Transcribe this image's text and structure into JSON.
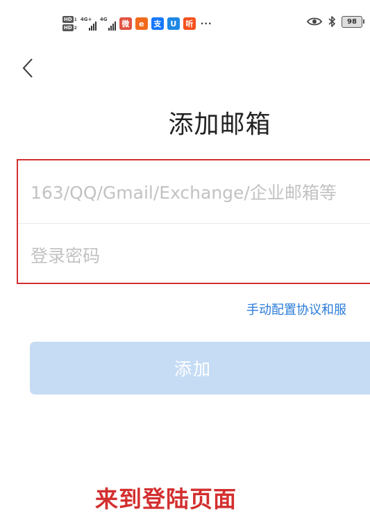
{
  "status_bar": {
    "hd1": "HD",
    "hd1_num": "1",
    "hd2": "HD",
    "hd2_num": "2",
    "net1": "4G+",
    "net2": "4G",
    "more": "···",
    "battery": "98",
    "apps": [
      {
        "icon": "weibo-app-icon",
        "glyph": "微",
        "color": "#e0523f"
      },
      {
        "icon": "aliexpress-app-icon",
        "glyph": "e",
        "color": "#f26b1d"
      },
      {
        "icon": "alipay-app-icon",
        "glyph": "支",
        "color": "#1677ff"
      },
      {
        "icon": "app-icon",
        "glyph": "U",
        "color": "#1e88e5"
      },
      {
        "icon": "listen-app-icon",
        "glyph": "听",
        "color": "#f4511e"
      }
    ]
  },
  "header": {
    "back_icon": "chevron-left-icon",
    "title": "添加邮箱"
  },
  "form": {
    "account_placeholder": "163/QQ/Gmail/Exchange/企业邮箱等",
    "password_placeholder": "登录密码",
    "manual_link": "手动配置协议和服",
    "add_button": "添加",
    "highlight_color": "#d32f2f",
    "button_color": "#c6dcf4"
  },
  "caption": "来到登陆页面"
}
